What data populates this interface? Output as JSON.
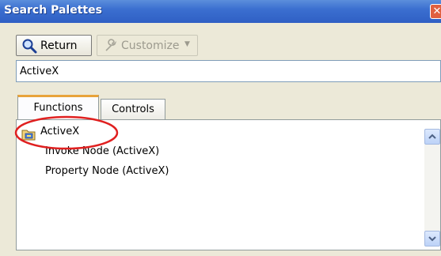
{
  "window": {
    "title": "Search Palettes"
  },
  "toolbar": {
    "return_label": "Return",
    "customize_label": "Customize"
  },
  "search": {
    "value": "ActiveX"
  },
  "tabs": [
    {
      "label": "Functions",
      "active": true
    },
    {
      "label": "Controls",
      "active": false
    }
  ],
  "results": [
    {
      "label": "ActiveX",
      "icon": "folder-icon"
    },
    {
      "label": "Invoke Node (ActiveX)"
    },
    {
      "label": "Property Node (ActiveX)"
    }
  ],
  "annotation": {
    "shape": "ellipse",
    "color": "#e02020"
  },
  "colors": {
    "titlebar": "#3b6fd0",
    "tab_accent": "#e8a33a",
    "window_bg": "#ece9d8"
  }
}
